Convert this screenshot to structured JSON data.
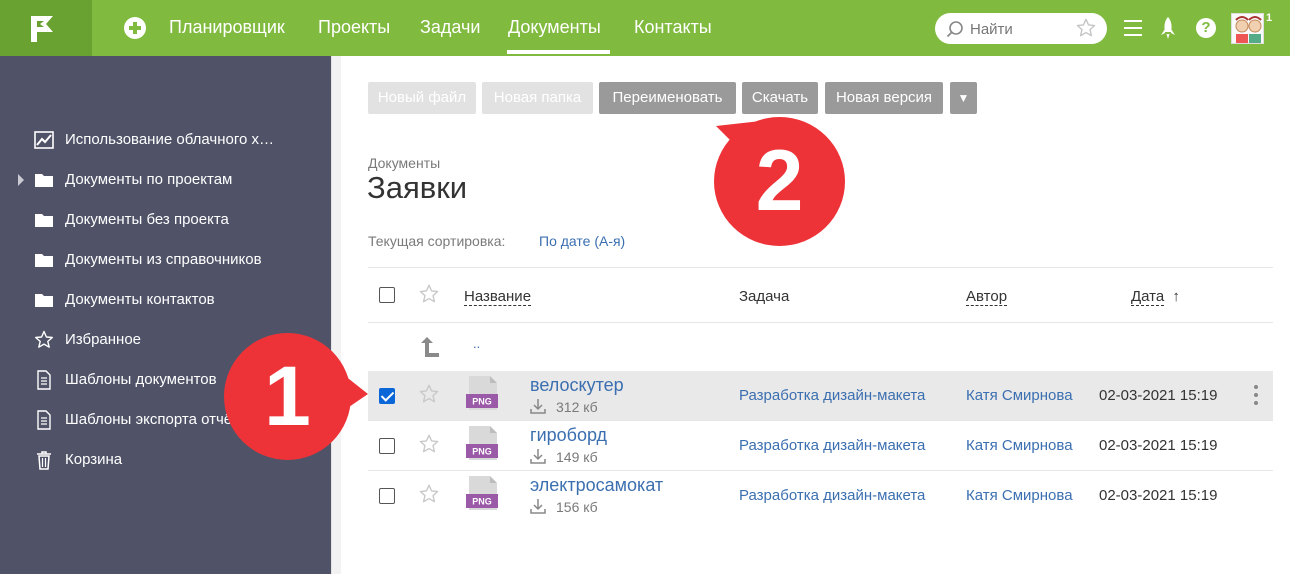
{
  "topbar": {
    "nav": [
      {
        "label": "Планировщик"
      },
      {
        "label": "Проекты"
      },
      {
        "label": "Задачи"
      },
      {
        "label": "Документы",
        "active": true
      },
      {
        "label": "Контакты"
      }
    ],
    "search_placeholder": "Найти",
    "help_glyph": "?",
    "notifications_count": "1",
    "accent_color": "#80bb3f"
  },
  "sidebar": {
    "items": [
      {
        "label": "Использование облачного хранилища",
        "icon": "chart-icon"
      },
      {
        "label": "Документы по проектам",
        "icon": "folder-icon",
        "expandable": true
      },
      {
        "label": "Документы без проекта",
        "icon": "folder-icon"
      },
      {
        "label": "Документы из справочников",
        "icon": "folder-icon"
      },
      {
        "label": "Документы контактов",
        "icon": "folder-icon"
      },
      {
        "label": "Избранное",
        "icon": "star-icon"
      },
      {
        "label": "Шаблоны документов",
        "icon": "document-icon"
      },
      {
        "label": "Шаблоны экспорта отчётов",
        "icon": "document-icon"
      },
      {
        "label": "Корзина",
        "icon": "trash-icon"
      }
    ]
  },
  "toolbar": {
    "new_file": "Новый файл",
    "new_folder": "Новая папка",
    "rename": "Переименовать",
    "download": "Скачать",
    "new_version": "Новая версия",
    "more": "▼"
  },
  "header": {
    "breadcrumb": "Документы",
    "title": "Заявки",
    "sort_label": "Текущая сортировка:",
    "sort_value": "По дате (А-я)"
  },
  "table": {
    "columns": {
      "name": "Название",
      "task": "Задача",
      "author": "Автор",
      "date": "Дата",
      "date_sort_glyph": "↑"
    },
    "up_link": "..",
    "rows": [
      {
        "name": "велоскутер",
        "size": "312 кб",
        "type": "PNG",
        "task": "Разработка дизайн-макета",
        "author": "Катя Смирнова",
        "date": "02-03-2021 15:19",
        "selected": true
      },
      {
        "name": "гироборд",
        "size": "149 кб",
        "type": "PNG",
        "task": "Разработка дизайн-макета",
        "author": "Катя Смирнова",
        "date": "02-03-2021 15:19",
        "selected": false
      },
      {
        "name": "электросамокат",
        "size": "156 кб",
        "type": "PNG",
        "task": "Разработка дизайн-макета",
        "author": "Катя Смирнова",
        "date": "02-03-2021 15:19",
        "selected": false
      }
    ]
  },
  "callouts": {
    "one": "1",
    "two": "2",
    "color": "#ee3338"
  }
}
